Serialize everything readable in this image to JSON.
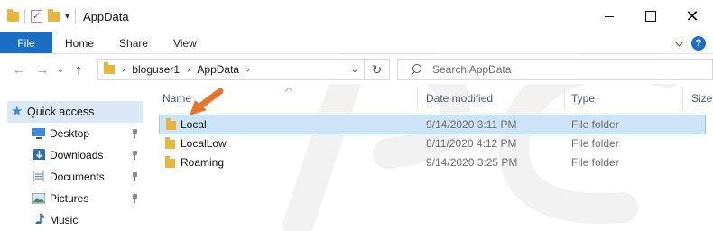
{
  "window": {
    "title": "AppData",
    "quick_access_toolbar": {
      "icons": [
        "folder-icon",
        "properties-check-icon",
        "new-folder-icon",
        "customize-down-icon"
      ]
    }
  },
  "ribbon": {
    "tabs": [
      {
        "label": "File",
        "active": true
      },
      {
        "label": "Home"
      },
      {
        "label": "Share"
      },
      {
        "label": "View"
      }
    ],
    "help_label": "?",
    "accent_color": "#1a6fc4"
  },
  "navigation": {
    "back_symbol": "←",
    "forward_symbol": "→",
    "recent_symbol": "⌄",
    "up_symbol": "↑",
    "breadcrumb": [
      "bloguser1",
      "AppData"
    ],
    "breadcrumb_separator": "›",
    "refresh_symbol": "↻",
    "dropdown_symbol": "⌄",
    "search_placeholder": "Search AppData"
  },
  "sidebar": {
    "items": [
      {
        "label": "Quick access",
        "icon": "star-icon",
        "selected": true
      },
      {
        "label": "Desktop",
        "icon": "desktop-icon",
        "pinned": true
      },
      {
        "label": "Downloads",
        "icon": "downloads-icon",
        "pinned": true
      },
      {
        "label": "Documents",
        "icon": "documents-icon",
        "pinned": true
      },
      {
        "label": "Pictures",
        "icon": "pictures-icon",
        "pinned": true
      },
      {
        "label": "Music",
        "icon": "music-icon",
        "pinned": false
      }
    ]
  },
  "file_list": {
    "columns": [
      "Name",
      "Date modified",
      "Type",
      "Size"
    ],
    "rows": [
      {
        "name": "Local",
        "date_modified": "9/14/2020 3:11 PM",
        "type": "File folder",
        "selected": true
      },
      {
        "name": "LocalLow",
        "date_modified": "8/11/2020 4:12 PM",
        "type": "File folder"
      },
      {
        "name": "Roaming",
        "date_modified": "9/14/2020 3:25 PM",
        "type": "File folder"
      }
    ]
  },
  "annotation": {
    "arrow_color": "#e8732a"
  }
}
